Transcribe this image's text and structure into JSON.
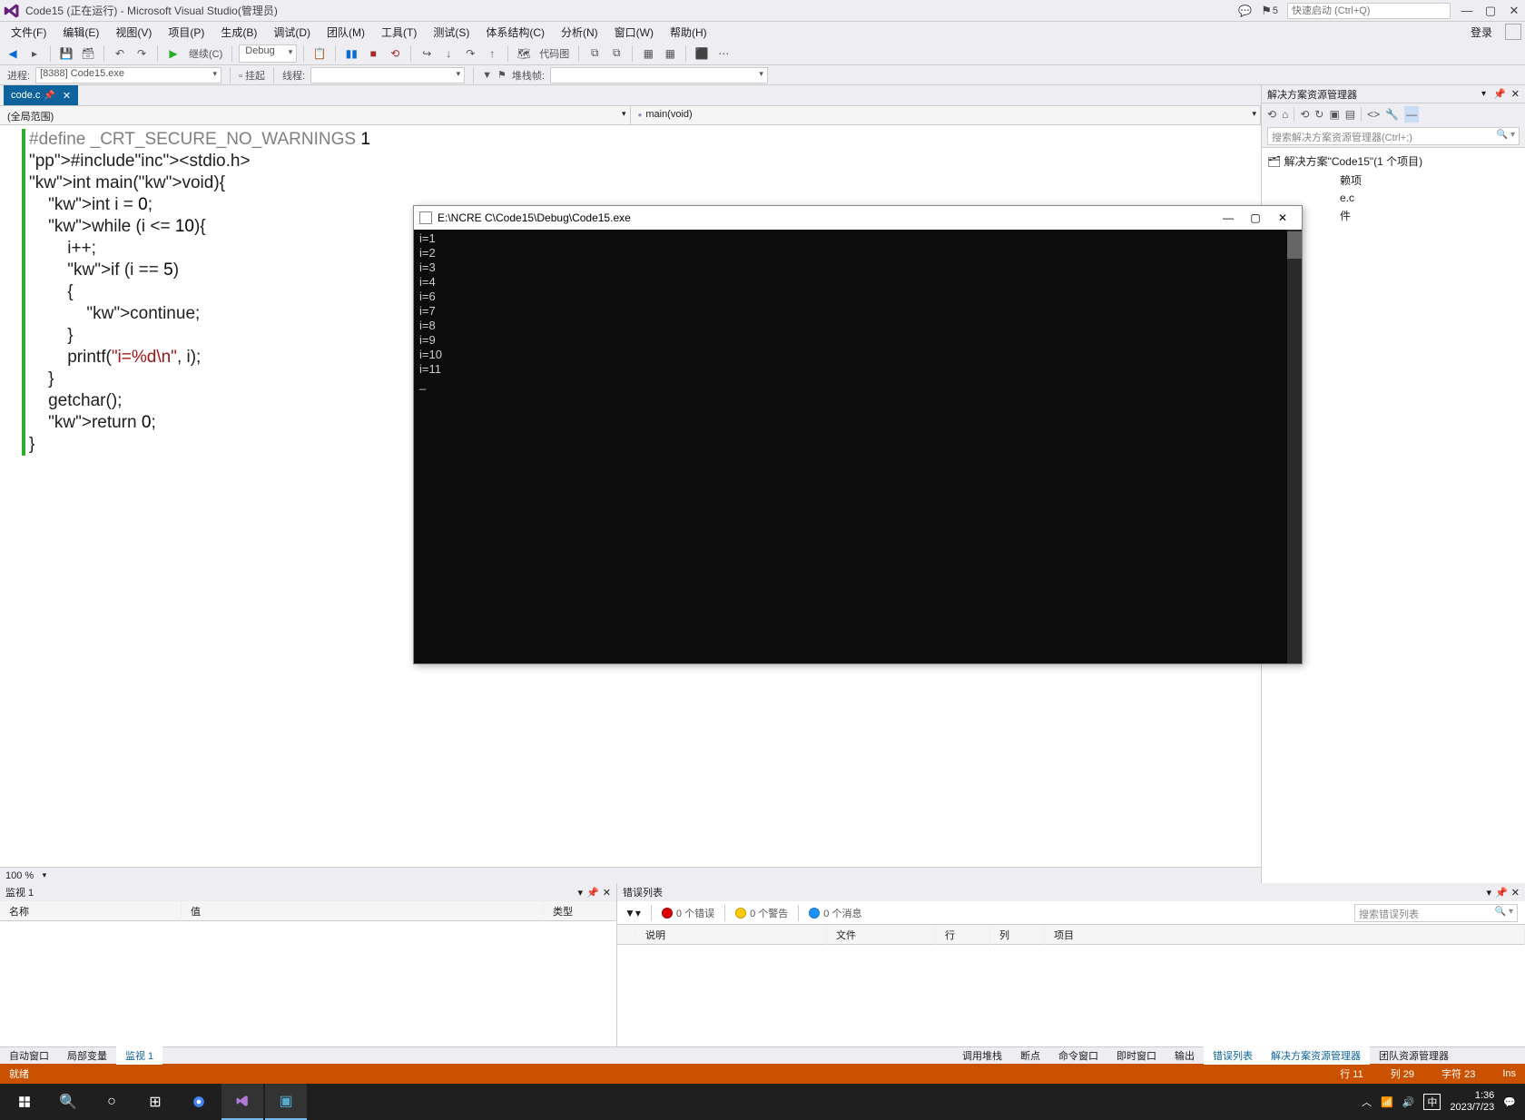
{
  "title_bar": {
    "title": "Code15 (正在运行) - Microsoft Visual Studio(管理员)",
    "notif_count": "5",
    "quick_launch_placeholder": "快速启动 (Ctrl+Q)"
  },
  "menu": {
    "items": [
      "文件(F)",
      "编辑(E)",
      "视图(V)",
      "项目(P)",
      "生成(B)",
      "调试(D)",
      "团队(M)",
      "工具(T)",
      "测试(S)",
      "体系结构(C)",
      "分析(N)",
      "窗口(W)",
      "帮助(H)"
    ],
    "login": "登录"
  },
  "toolbar": {
    "continue": "继续(C)",
    "config": "Debug",
    "code_map": "代码图"
  },
  "toolbar2": {
    "process_label": "进程:",
    "process_value": "[8388] Code15.exe",
    "suspend": "挂起",
    "thread": "线程:",
    "stackframe": "堆栈帧:"
  },
  "tab": {
    "name": "code.c"
  },
  "scope": {
    "global": "(全局范围)",
    "func": "main(void)"
  },
  "code": {
    "lines": [
      {
        "t": "#define",
        "c": "pp",
        "rest": " _CRT_SECURE_NO_WARNINGS ",
        "suffix": "1"
      },
      {
        "raw": "#include<stdio.h>"
      },
      {
        "raw": "int main(void){"
      },
      {
        "raw": "    int i = 0;"
      },
      {
        "raw": "    while (i <= 10){"
      },
      {
        "raw": "        i++;"
      },
      {
        "raw": "        if (i == 5)"
      },
      {
        "raw": "        {"
      },
      {
        "raw": "            continue;"
      },
      {
        "raw": "        }"
      },
      {
        "raw": "        printf(\"i=%d\\n\", i);"
      },
      {
        "raw": "    }"
      },
      {
        "raw": "    getchar();"
      },
      {
        "raw": "    return 0;"
      },
      {
        "raw": "}"
      }
    ],
    "zoom": "100 %"
  },
  "console": {
    "title": "E:\\NCRE C\\Code15\\Debug\\Code15.exe",
    "output": [
      "i=1",
      "i=2",
      "i=3",
      "i=4",
      "i=6",
      "i=7",
      "i=8",
      "i=9",
      "i=10",
      "i=11"
    ]
  },
  "solution_explorer": {
    "title": "解决方案资源管理器",
    "search_placeholder": "搜索解决方案资源管理器(Ctrl+;)",
    "root": "解决方案\"Code15\"(1 个项目)",
    "nodes": [
      "赖项",
      "e.c",
      "件"
    ]
  },
  "watch": {
    "title": "监视 1",
    "cols": {
      "name": "名称",
      "value": "值",
      "type": "类型"
    }
  },
  "error_list": {
    "title": "错误列表",
    "filters": {
      "errors": "0 个错误",
      "warnings": "0 个警告",
      "messages": "0 个消息"
    },
    "search_placeholder": "搜索错误列表",
    "cols": {
      "desc": "说明",
      "file": "文件",
      "line": "行",
      "col": "列",
      "project": "项目"
    }
  },
  "bottom_tabs_left": [
    "自动窗口",
    "局部变量",
    "监视 1"
  ],
  "bottom_tabs_left_active": 2,
  "bottom_tabs_mid": [
    "调用堆栈",
    "断点",
    "命令窗口",
    "即时窗口",
    "输出",
    "错误列表"
  ],
  "bottom_tabs_mid_active": 5,
  "bottom_tabs_right": [
    "解决方案资源管理器",
    "团队资源管理器"
  ],
  "bottom_tabs_right_active": 0,
  "status": {
    "state": "就绪",
    "line": "行 11",
    "col": "列 29",
    "char": "字符 23",
    "ins": "Ins"
  },
  "taskbar": {
    "ime": "中",
    "time": "1:36",
    "date": "2023/7/23"
  }
}
